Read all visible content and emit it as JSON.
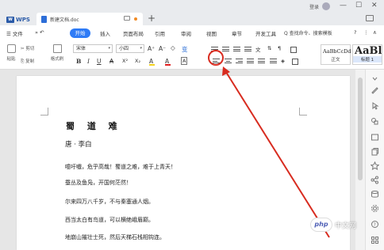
{
  "titlebar": {
    "app_tab": "WPS",
    "doc_tab": "新建文档.doc",
    "add_tab": "+",
    "login": "登录",
    "minimize": "—",
    "maximize": "☐",
    "close": "✕"
  },
  "menu": {
    "file": "☰ 文件",
    "start": "开始",
    "insert": "插入",
    "layout": "页面布局",
    "reference": "引用",
    "review": "审阅",
    "view": "视图",
    "section": "章节",
    "dev": "开发工具",
    "search": "Q 查找命令、搜索模板",
    "help": "?",
    "more": "⋮",
    "collapse": "∧"
  },
  "ribbon": {
    "paste": "粘贴",
    "cut": "剪切",
    "copy": "复制",
    "format_painter": "格式刷",
    "font_name": "宋体",
    "font_size": "小四",
    "grow": "A⁺",
    "shrink": "A⁻",
    "clear": "◇",
    "pinyin": "变",
    "bold": "B",
    "italic": "I",
    "underline": "U",
    "strike": "A",
    "superscript": "X²",
    "subscript": "X₂",
    "highlight": "A",
    "font_color": "A",
    "char_border": "A",
    "style_body_sample": "AaBbCcDd",
    "style_body_name": "正文",
    "style_h1_sample": "AaBl",
    "style_h1_name": "标题 1"
  },
  "colors": {
    "accent": "#2e7bf6",
    "highlight_ring": "#d82c20",
    "arrow": "#d82c20",
    "font_color_bar": "#e02020",
    "highlight_bar": "#f3d21f"
  },
  "document": {
    "title": "蜀 道 难",
    "author": "唐 · 李白",
    "lines": [
      "噫吁嚱，危乎高哉！蜀道之难，难于上青天！",
      "蚕丛及鱼凫，开国何茫然！",
      "尔来四万八千岁，不与秦塞通人烟。",
      "西当太白有鸟道，可以横绝峨眉巅。",
      "地崩山摧壮士死，然后天梯石栈相钩连。"
    ]
  },
  "watermark": {
    "logo": "php",
    "text": "中文网"
  }
}
